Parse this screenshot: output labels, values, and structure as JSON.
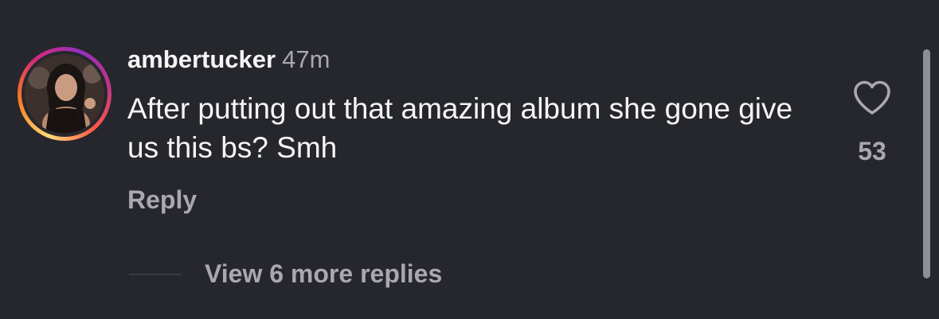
{
  "comment": {
    "username": "ambertucker",
    "time_ago": "47m",
    "text": "After putting out that amazing album she gone give us this bs? Smh",
    "reply_label": "Reply",
    "like_count": "53",
    "view_replies_label": "View 6 more replies"
  },
  "icons": {
    "like": "heart-outline-icon",
    "avatar": "user-avatar-with-story-ring"
  },
  "colors": {
    "background": "#25272c",
    "primary_text": "#f5f5f5",
    "secondary_text": "#a8a8ae",
    "story_ring": [
      "#feda75",
      "#fa7e1e",
      "#d62976",
      "#962fbf"
    ]
  }
}
